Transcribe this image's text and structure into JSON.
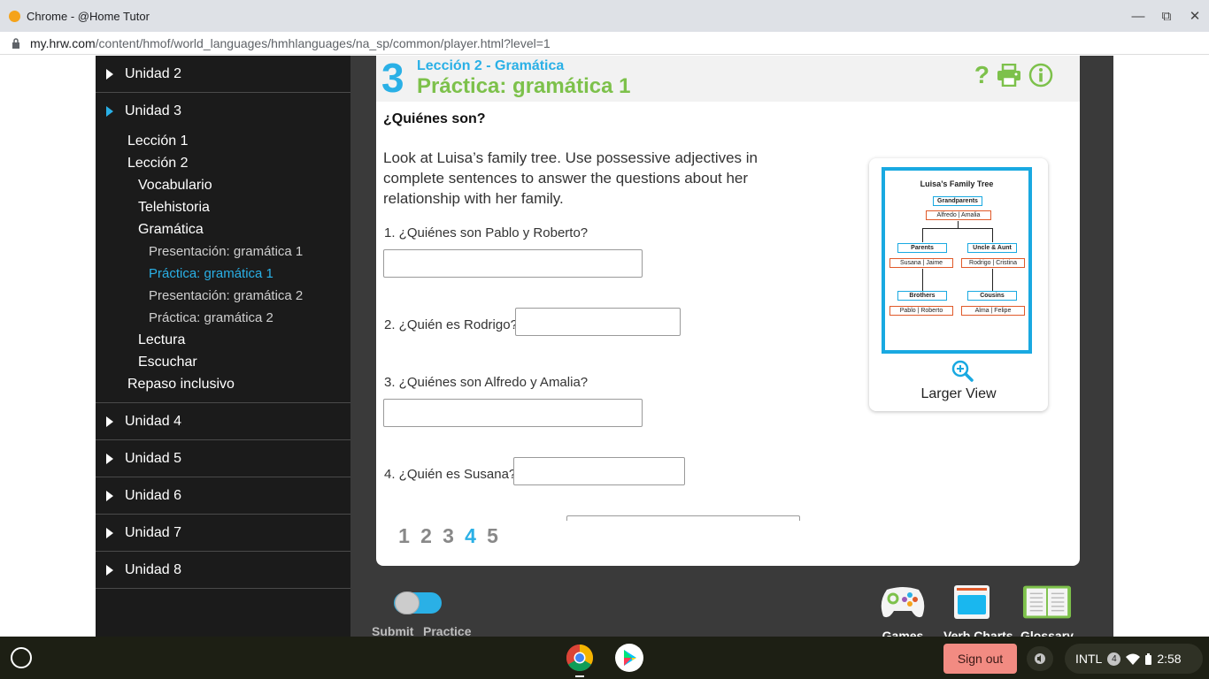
{
  "window": {
    "title": "Chrome - @Home Tutor",
    "minimize": "—",
    "maximize": "⧉",
    "close": "✕"
  },
  "urlbar": {
    "host": "my.hrw.com",
    "path": "/content/hmof/world_languages/hmhlanguages/na_sp/common/player.html?level=1"
  },
  "sidebar": {
    "unit2": "Unidad 2",
    "unit3": "Unidad 3",
    "leccion1": "Lección 1",
    "leccion2": "Lección 2",
    "vocabulario": "Vocabulario",
    "telehistoria": "Telehistoria",
    "gramatica": "Gramática",
    "pres1": "Presentación: gramática 1",
    "prac1": "Práctica: gramática 1",
    "pres2": "Presentación: gramática 2",
    "prac2": "Práctica: gramática 2",
    "lectura": "Lectura",
    "escuchar": "Escuchar",
    "repaso": "Repaso inclusivo",
    "unit4": "Unidad 4",
    "unit5": "Unidad 5",
    "unit6": "Unidad 6",
    "unit7": "Unidad 7",
    "unit8": "Unidad 8"
  },
  "header": {
    "number": "3",
    "subtitle": "Lección 2 - Gramática",
    "title": "Práctica: gramática 1",
    "help": "?"
  },
  "activity": {
    "title": "¿Quiénes son?",
    "instructions": "Look at Luisa’s family tree. Use possessive adjectives in complete sentences to answer the questions about her relationship with her family.",
    "q1": "1. ¿Quiénes son Pablo y Roberto?",
    "q2": "2. ¿Quién es Rodrigo?",
    "q3": "3. ¿Quiénes son Alfredo y Amalia?",
    "q4": "4. ¿Quién es Susana?",
    "a1": "",
    "a2": "",
    "a3": "",
    "a4": ""
  },
  "tree": {
    "title": "Luisa’s Family Tree",
    "grandparents": "Grandparents",
    "grandparent_names": "Alfredo | Amalia",
    "parents": "Parents",
    "parent_names": "Susana | Jaime",
    "uncle_aunt": "Uncle & Aunt",
    "uncle_aunt_names": "Rodrigo | Cristina",
    "brothers": "Brothers",
    "brother_names": "Pablo | Roberto",
    "cousins": "Cousins",
    "cousin_names": "Alma | Felipe",
    "larger_view": "Larger View"
  },
  "pager": {
    "p1": "1",
    "p2": "2",
    "p3": "3",
    "p4": "4",
    "p5": "5",
    "current": 4
  },
  "controls": {
    "submit": "Submit",
    "practice": "Practice",
    "games": "Games",
    "verb_charts": "Verb Charts",
    "glossary": "Glossary"
  },
  "shelf": {
    "sign_out": "Sign out",
    "ime": "INTL",
    "notifications": "4",
    "time": "2:58"
  },
  "colors": {
    "accent_blue": "#2ab0e6",
    "accent_green": "#7dc14b",
    "sidebar_bg": "#1b1b1b",
    "stage_bg": "#3a3a3a"
  }
}
